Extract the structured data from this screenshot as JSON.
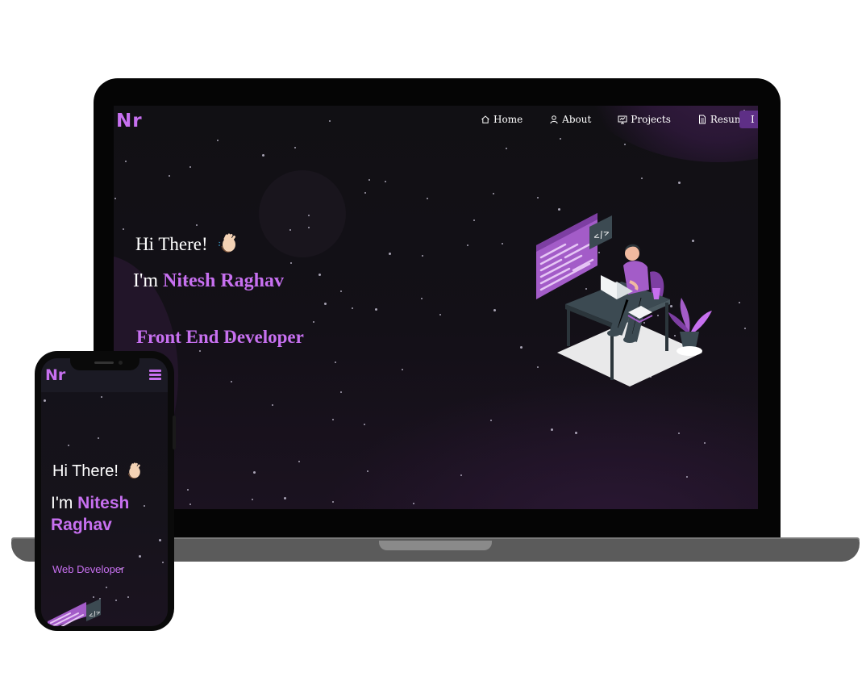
{
  "brand": {
    "logo": "Nr",
    "accent": "#c770f0"
  },
  "desktop": {
    "nav": {
      "items": [
        {
          "label": "Home",
          "icon": "home-icon"
        },
        {
          "label": "About",
          "icon": "user-icon"
        },
        {
          "label": "Projects",
          "icon": "projects-icon"
        },
        {
          "label": "Resume",
          "icon": "document-icon"
        }
      ],
      "fork_label": "I"
    },
    "hero": {
      "greeting": "Hi There!",
      "intro_prefix": "I'm ",
      "name": "Nitesh Raghav",
      "role": "Front End Developer"
    }
  },
  "mobile": {
    "hero": {
      "greeting": "Hi There!",
      "intro_prefix": "I'm ",
      "name": "Nitesh Raghav",
      "role": "Web Developer"
    }
  },
  "colors": {
    "background": "#131017",
    "text": "#ffffff",
    "button": "#5e2f86"
  }
}
